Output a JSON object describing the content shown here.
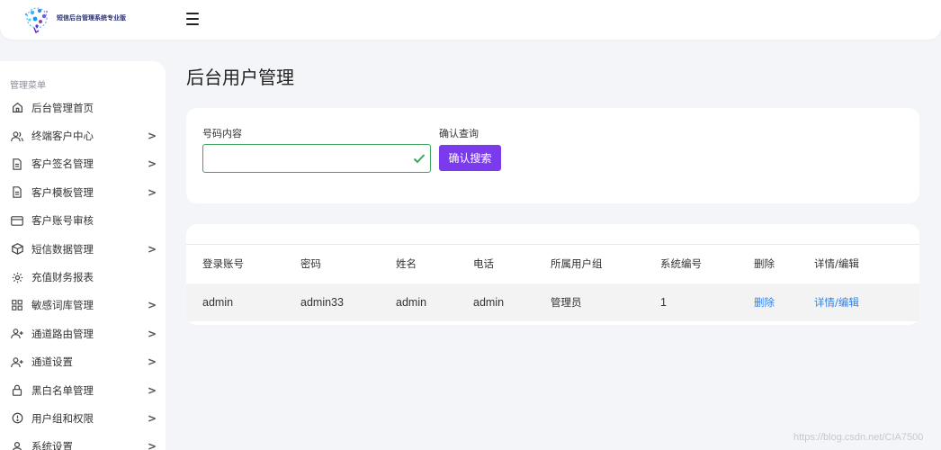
{
  "header": {
    "logo_text": "短信后台管理系统专业版"
  },
  "sidebar": {
    "title": "管理菜单",
    "items": [
      {
        "label": "后台管理首页",
        "icon": "home-icon",
        "has_submenu": false
      },
      {
        "label": "终端客户中心",
        "icon": "users-icon",
        "has_submenu": true
      },
      {
        "label": "客户签名管理",
        "icon": "document-icon",
        "has_submenu": true
      },
      {
        "label": "客户模板管理",
        "icon": "document-icon",
        "has_submenu": true
      },
      {
        "label": "客户账号审核",
        "icon": "card-icon",
        "has_submenu": false
      },
      {
        "label": "短信数据管理",
        "icon": "cube-icon",
        "has_submenu": true
      },
      {
        "label": "充值财务报表",
        "icon": "gear-icon",
        "has_submenu": false
      },
      {
        "label": "敏感词库管理",
        "icon": "grid-icon",
        "has_submenu": true
      },
      {
        "label": "通道路由管理",
        "icon": "user-plus-icon",
        "has_submenu": true
      },
      {
        "label": "通道设置",
        "icon": "user-plus-icon",
        "has_submenu": true
      },
      {
        "label": "黑白名单管理",
        "icon": "lock-icon",
        "has_submenu": true
      },
      {
        "label": "用户组和权限",
        "icon": "alert-circle-icon",
        "has_submenu": true
      },
      {
        "label": "系统设置",
        "icon": "user-icon",
        "has_submenu": true
      }
    ]
  },
  "main": {
    "title": "后台用户管理",
    "search": {
      "phone_label": "号码内容",
      "phone_value": "",
      "phone_placeholder": "",
      "query_label": "确认查询",
      "button_label": "确认搜索"
    },
    "table": {
      "columns": [
        "登录账号",
        "密码",
        "姓名",
        "电话",
        "所属用户组",
        "系统编号",
        "删除",
        "详情/编辑"
      ],
      "rows": [
        {
          "account": "admin",
          "password": "admin33",
          "name": "admin",
          "phone": "admin",
          "group": "管理员",
          "sys_id": "1",
          "delete": "删除",
          "edit": "详情/编辑"
        }
      ]
    }
  },
  "watermark": "https://blog.csdn.net/CIA7500",
  "colors": {
    "accent": "#7c3aed",
    "link": "#2f80ed",
    "success": "#3aa55d",
    "background": "#f4f5f8"
  }
}
